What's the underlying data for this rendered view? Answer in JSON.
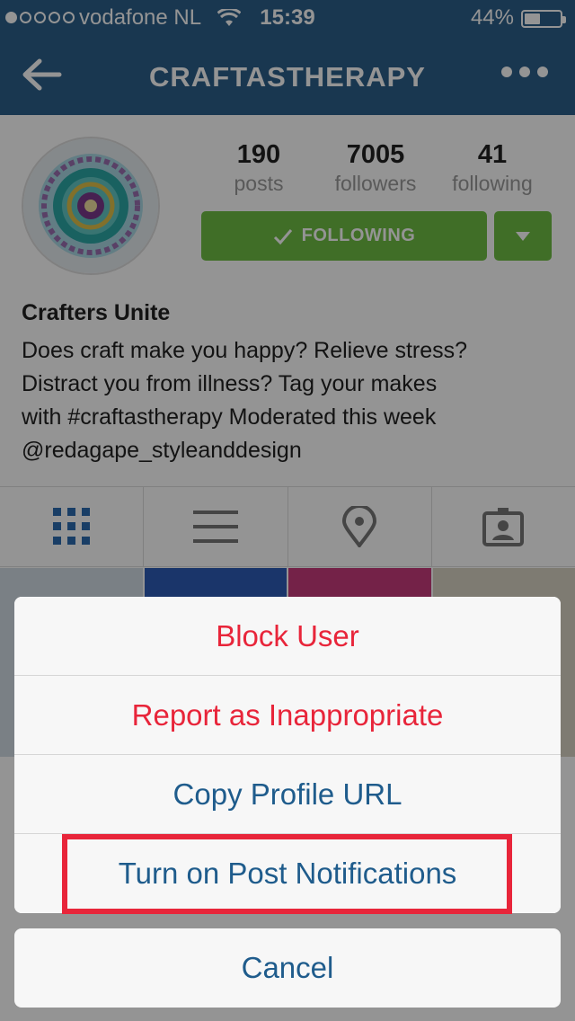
{
  "status_bar": {
    "carrier": "vodafone NL",
    "time": "15:39",
    "battery_percent": "44%",
    "battery_level": 0.44,
    "signal_bars_filled": 1,
    "signal_bars_total": 5
  },
  "nav": {
    "title": "CRAFTASTHERAPY",
    "back_icon": "arrow-left-icon",
    "more_icon": "more-dots-icon"
  },
  "profile": {
    "stats": [
      {
        "value": "190",
        "label": "posts"
      },
      {
        "value": "7005",
        "label": "followers"
      },
      {
        "value": "41",
        "label": "following"
      }
    ],
    "follow_button_label": "FOLLOWING",
    "name": "Crafters Unite",
    "bio_lines": [
      "Does craft make you happy? Relieve stress?",
      "Distract you from illness? Tag your makes",
      "with #craftastherapy Moderated this week",
      "@redagape_styleanddesign"
    ]
  },
  "tabs": [
    {
      "icon": "grid-icon",
      "active": true
    },
    {
      "icon": "list-icon",
      "active": false
    },
    {
      "icon": "location-pin-icon",
      "active": false
    },
    {
      "icon": "tagged-person-icon",
      "active": false
    }
  ],
  "action_sheet": {
    "actions": [
      {
        "label": "Block User",
        "style": "destructive"
      },
      {
        "label": "Report as Inappropriate",
        "style": "destructive"
      },
      {
        "label": "Copy Profile URL",
        "style": "default"
      },
      {
        "label": "Turn on Post Notifications",
        "style": "default",
        "highlighted": true
      }
    ],
    "cancel_label": "Cancel"
  },
  "colors": {
    "nav_bar": "#2b5f8b",
    "follow_green": "#6fbe44",
    "destructive_red": "#e8253a",
    "action_blue": "#1f5c8c"
  }
}
